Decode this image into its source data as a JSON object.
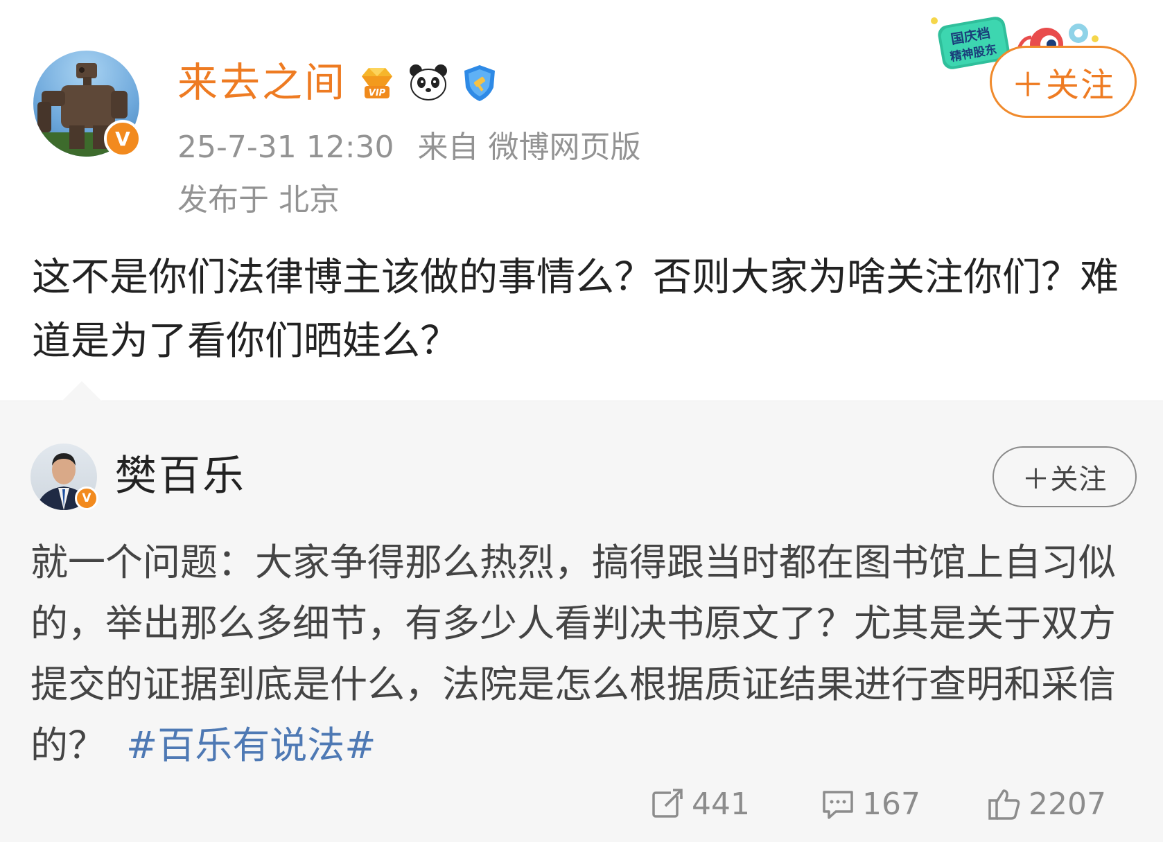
{
  "post": {
    "username": "来去之间",
    "badges": [
      "vip-diamond-badge",
      "panda-badge",
      "shield-badge"
    ],
    "vip_label": "VIP",
    "time": "25-7-31 12:30",
    "source": "来自 微博网页版",
    "location": "发布于 北京",
    "follow_label": "＋关注",
    "promo_text": "国庆档 精神股东",
    "text": "这不是你们法律博主该做的事情么？否则大家为啥关注你们？难道是为了看你们晒娃么？"
  },
  "quoted": {
    "username": "樊百乐",
    "follow_label": "＋关注",
    "text": "就一个问题：大家争得那么热烈，搞得跟当时都在图书馆上自习似的，举出那么多细节，有多少人看判决书原文了？尤其是关于双方提交的证据到底是什么，法院是怎么根据质证结果进行查明和采信的？",
    "hashtag": "#百乐有说法#",
    "actions": {
      "repost_count": "441",
      "comment_count": "167",
      "like_count": "2207"
    }
  },
  "colors": {
    "accent_orange": "#ee7b22",
    "hashtag_blue": "#4e79b4",
    "meta_gray": "#939393"
  }
}
